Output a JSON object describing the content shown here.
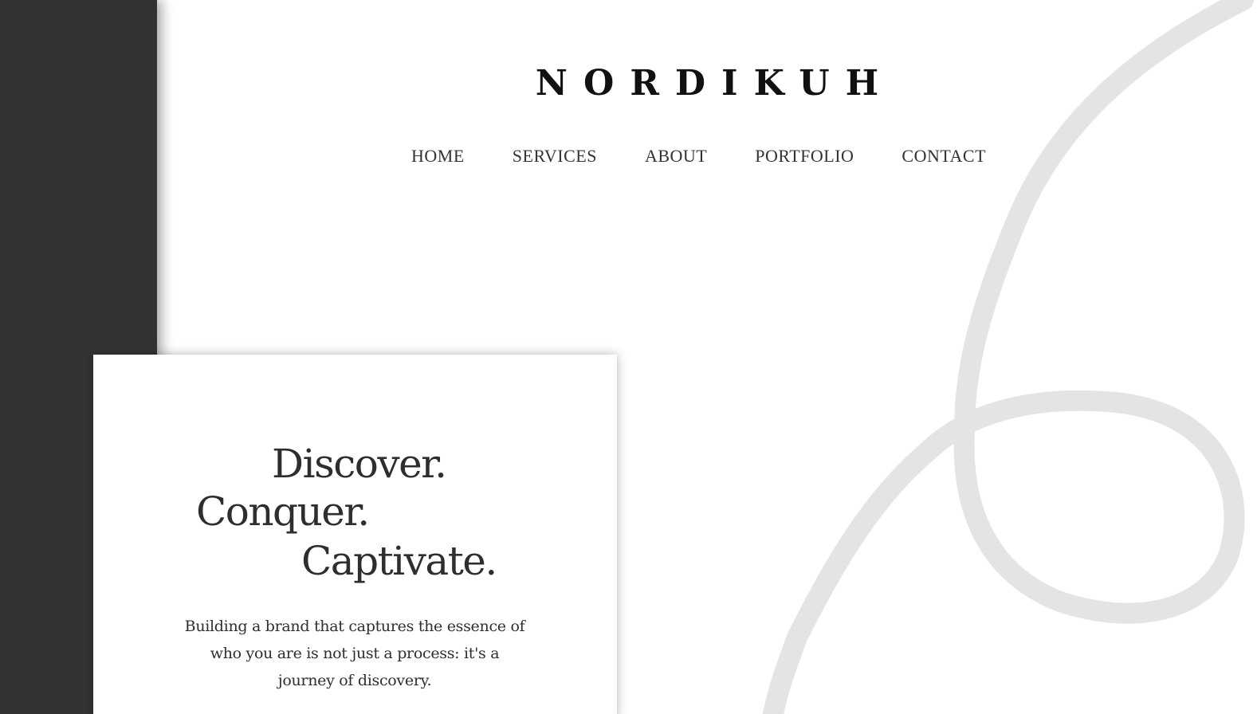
{
  "brand": {
    "logo_text": "NORDIKUH"
  },
  "nav": {
    "items": [
      {
        "label": "HOME"
      },
      {
        "label": "SERVICES"
      },
      {
        "label": "ABOUT"
      },
      {
        "label": "PORTFOLIO"
      },
      {
        "label": "CONTACT"
      }
    ]
  },
  "hero": {
    "headline_line1": "Discover.",
    "headline_line2": "Conquer.",
    "headline_line3": "Captivate.",
    "tagline": "Building a brand that captures the essence of who you are is not just a process: it's a journey of discovery."
  },
  "colors": {
    "sidebar": "#333333",
    "text": "#2e2e2e",
    "swirl": "#e4e4e4",
    "background": "#ffffff"
  },
  "decoration": {
    "swirl_icon": "brush-stroke-swirl-icon"
  }
}
